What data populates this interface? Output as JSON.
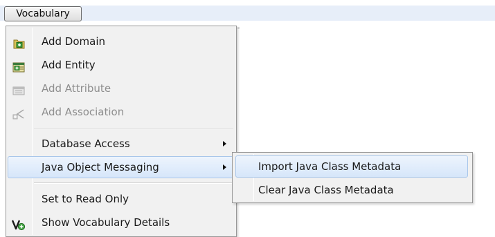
{
  "menubar": {
    "title": "Vocabulary"
  },
  "menu": {
    "items": [
      {
        "label": "Add Domain",
        "icon": "add-domain-icon",
        "disabled": false
      },
      {
        "label": "Add Entity",
        "icon": "add-entity-icon",
        "disabled": false
      },
      {
        "label": "Add Attribute",
        "icon": "add-attribute-icon",
        "disabled": true
      },
      {
        "label": "Add Association",
        "icon": "add-association-icon",
        "disabled": true
      },
      {
        "label": "Database Access",
        "has_submenu": true
      },
      {
        "label": "Java Object Messaging",
        "has_submenu": true,
        "highlighted": true
      },
      {
        "label": "Set to Read Only"
      },
      {
        "label": "Show Vocabulary Details",
        "icon": "vocabulary-details-icon"
      }
    ]
  },
  "submenu": {
    "items": [
      {
        "label": "Import Java Class Metadata",
        "highlighted": true
      },
      {
        "label": "Clear Java Class Metadata"
      }
    ]
  },
  "colors": {
    "highlight_border": "#a8c6ea",
    "highlight_fill": "#d6e6fa",
    "menu_background": "#f1f1f1",
    "disabled_text": "#8e8e8e"
  }
}
